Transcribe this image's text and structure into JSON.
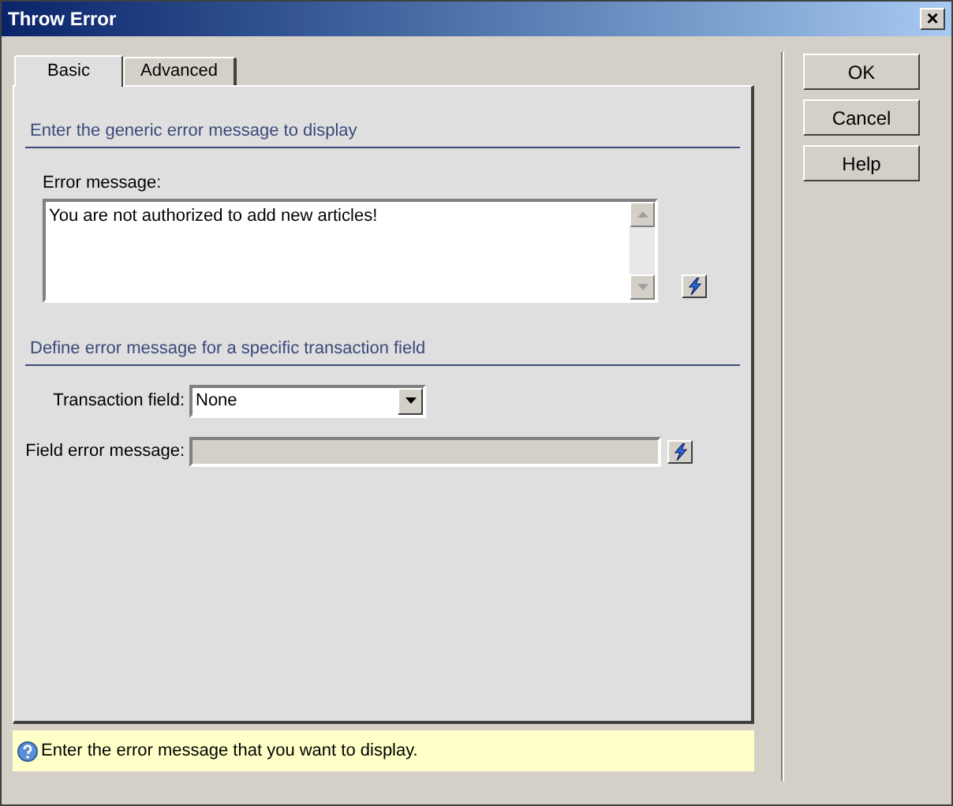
{
  "window": {
    "title": "Throw Error",
    "close": "×"
  },
  "tabs": [
    {
      "label": "Basic",
      "selected": true
    },
    {
      "label": "Advanced",
      "selected": false
    }
  ],
  "sections": [
    {
      "heading": "Enter the generic error message to display"
    },
    {
      "heading": "Define error message for a specific transaction field"
    }
  ],
  "error_message": {
    "label": "Error message:",
    "value": "You are not authorized to add new articles!"
  },
  "transaction_field": {
    "label": "Transaction field:",
    "value": "None"
  },
  "field_error_message": {
    "label": "Field error message:",
    "disabled": true
  },
  "help_bar": {
    "text": "Enter the error message that you want to display."
  },
  "buttons": [
    "OK",
    "Cancel",
    "Help"
  ]
}
